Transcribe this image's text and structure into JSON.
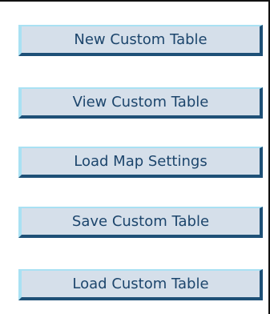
{
  "menu": {
    "buttons": [
      {
        "label": "New Custom Table"
      },
      {
        "label": "View Custom Table"
      },
      {
        "label": "Load Map Settings"
      },
      {
        "label": "Save Custom Table"
      },
      {
        "label": "Load Custom Table"
      }
    ]
  },
  "colors": {
    "button_face": "#d5dfea",
    "button_highlight": "#a9e1f3",
    "button_shadow": "#1e5077",
    "button_text": "#1c456c",
    "panel_border": "#111111"
  }
}
